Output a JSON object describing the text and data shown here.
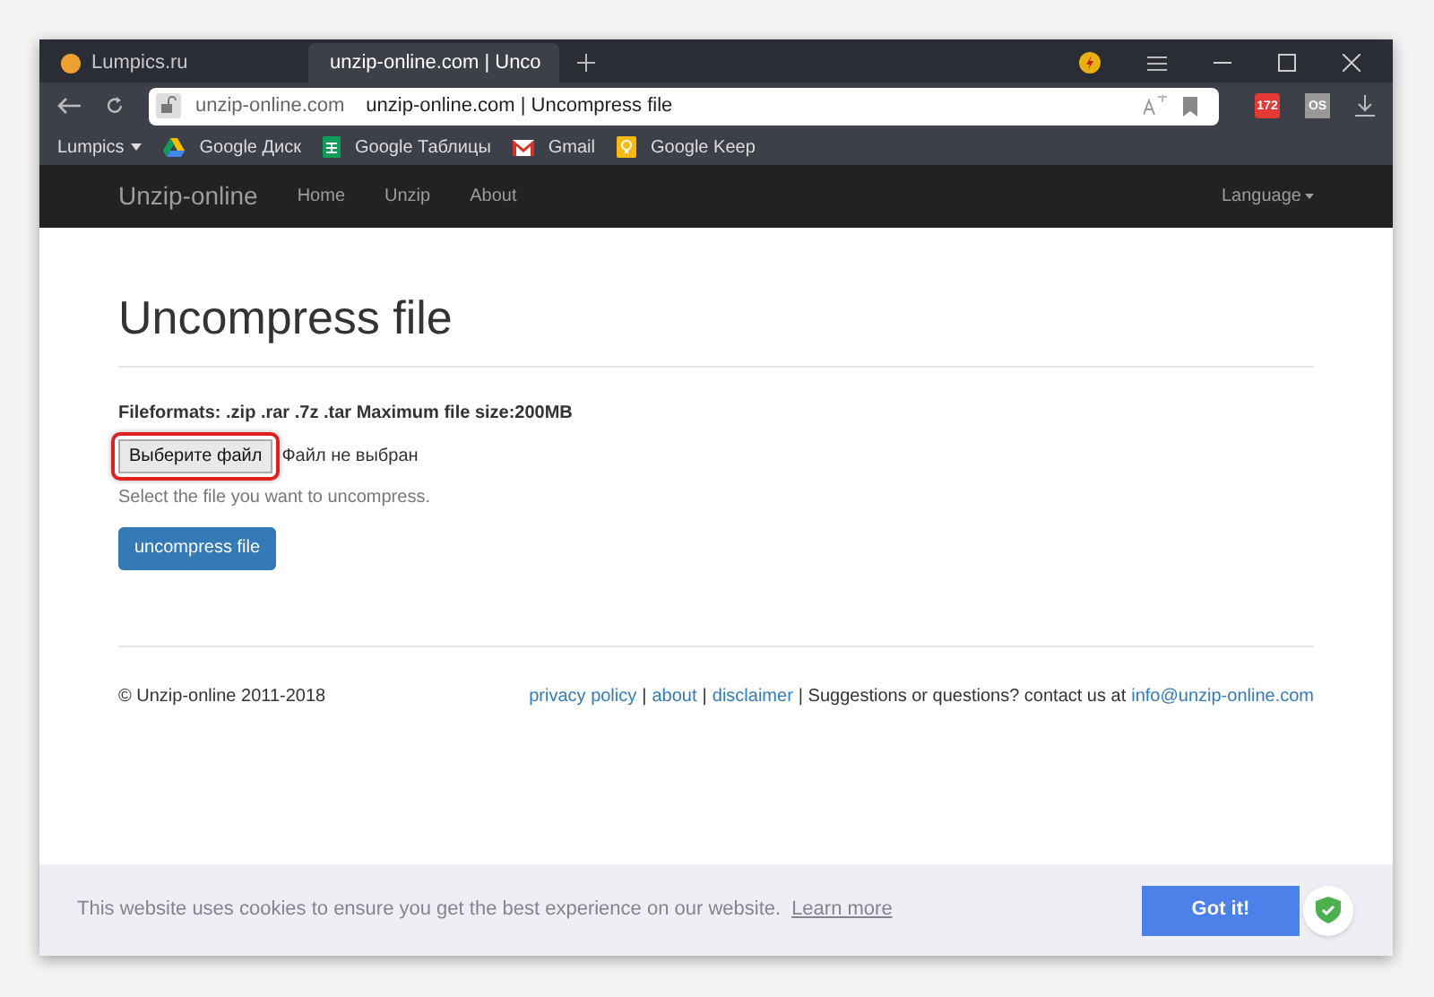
{
  "browser": {
    "tabs": [
      {
        "title": "Lumpics.ru",
        "selected": false,
        "kind": "site"
      },
      {
        "title": "unzip-online.com | Unco",
        "selected": true,
        "kind": "page"
      }
    ],
    "address": {
      "domain": "unzip-online.com",
      "title": "unzip-online.com | Uncompress file"
    },
    "extension_badge": "172",
    "extension_label": "OS",
    "bookmarks": [
      {
        "label": "Lumpics",
        "kind": "folder"
      },
      {
        "label": "Google Диск",
        "kind": "drive"
      },
      {
        "label": "Google Таблицы",
        "kind": "sheets"
      },
      {
        "label": "Gmail",
        "kind": "gmail"
      },
      {
        "label": "Google Keep",
        "kind": "keep"
      }
    ]
  },
  "site_nav": {
    "brand": "Unzip-online",
    "links": [
      "Home",
      "Unzip",
      "About"
    ],
    "language": "Language"
  },
  "page": {
    "title": "Uncompress file",
    "formats": "Fileformats: .zip .rar .7z .tar Maximum file size:200MB",
    "file_button": "Выберите файл",
    "file_status": "Файл не выбран",
    "help": "Select the file you want to uncompress.",
    "submit": "uncompress file"
  },
  "footer": {
    "copyright": "© Unzip-online 2011-2018",
    "parts": [
      {
        "text": "privacy policy",
        "kind": "link"
      },
      {
        "text": "|",
        "kind": "text"
      },
      {
        "text": "about",
        "kind": "link"
      },
      {
        "text": "|",
        "kind": "text"
      },
      {
        "text": "disclaimer",
        "kind": "link"
      },
      {
        "text": "| Suggestions or questions? contact us at",
        "kind": "text"
      },
      {
        "text": "info@unzip-online.com",
        "kind": "link"
      }
    ]
  },
  "cookie_bar": {
    "message": "This website uses cookies to ensure you get the best experience on our website.",
    "learn_more": "Learn more",
    "button": "Got it!"
  }
}
